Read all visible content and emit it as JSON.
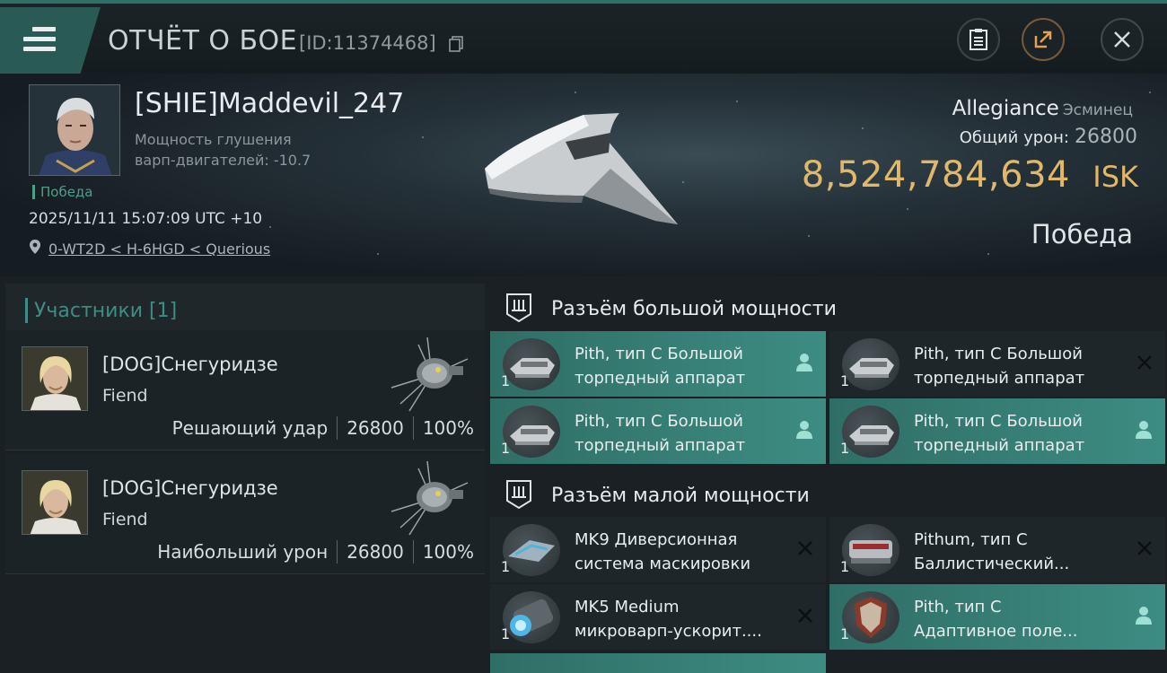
{
  "header": {
    "title": "ОТЧЁТ О БОЕ",
    "report_id": "[ID:11374468]"
  },
  "victim": {
    "pilot": "[SHIE]Maddevil_247",
    "warp_label_1": "Мощность глушения",
    "warp_label_2": "варп-двигателей: -10.7",
    "tag": "Победа",
    "datetime": "2025/11/11 15:07:09 UTC +10",
    "location": "0-WT2D < H-6HGD < Querious",
    "ship_name": "Allegiance",
    "ship_class": "Эсминец",
    "damage_label": "Общий урон:",
    "damage_value": "26800",
    "isk_value": "8,524,784,634",
    "isk_unit": "ISK",
    "result": "Победа"
  },
  "participants": {
    "header": "Участники [1]",
    "rows": [
      {
        "name": "[DOG]Снегуридзе",
        "ship": "Fiend",
        "role": "Решающий удар",
        "damage": "26800",
        "percent": "100%"
      },
      {
        "name": "[DOG]Снегуридзе",
        "ship": "Fiend",
        "role": "Наибольший урон",
        "damage": "26800",
        "percent": "100%"
      }
    ]
  },
  "high_slots": {
    "title": "Разъём большой мощности",
    "items": [
      {
        "line1": "Pith, тип C Большой",
        "line2": "торпедный аппарат",
        "qty": "1",
        "status": "dropped"
      },
      {
        "line1": "Pith, тип C Большой",
        "line2": "торпедный аппарат",
        "qty": "1",
        "status": "destroyed"
      },
      {
        "line1": "Pith, тип C Большой",
        "line2": "торпедный аппарат",
        "qty": "1",
        "status": "dropped"
      },
      {
        "line1": "Pith, тип C Большой",
        "line2": "торпедный аппарат",
        "qty": "1",
        "status": "dropped"
      }
    ]
  },
  "low_slots": {
    "title": "Разъём малой мощности",
    "items": [
      {
        "line1": "MK9 Диверсионная",
        "line2": "система маскировки",
        "qty": "1",
        "status": "destroyed"
      },
      {
        "line1": "Pithum, тип C",
        "line2": "Баллистический...",
        "qty": "1",
        "status": "destroyed"
      },
      {
        "line1": "MK5 Medium",
        "line2": "микроварп-ускорит....",
        "qty": "1",
        "status": "destroyed"
      },
      {
        "line1": "Pith, тип C",
        "line2": "Адаптивное поле...",
        "qty": "1",
        "status": "dropped"
      }
    ]
  },
  "colors": {
    "accent_teal": "#3d8c83",
    "isk_gold": "#e1b76a",
    "victory_green": "#4aa088"
  },
  "icons": [
    "menu-icon",
    "copy-icon",
    "clipboard-icon",
    "share-icon",
    "close-icon",
    "location-pin-icon",
    "slot-icon",
    "person-icon",
    "destroyed-x-icon"
  ]
}
